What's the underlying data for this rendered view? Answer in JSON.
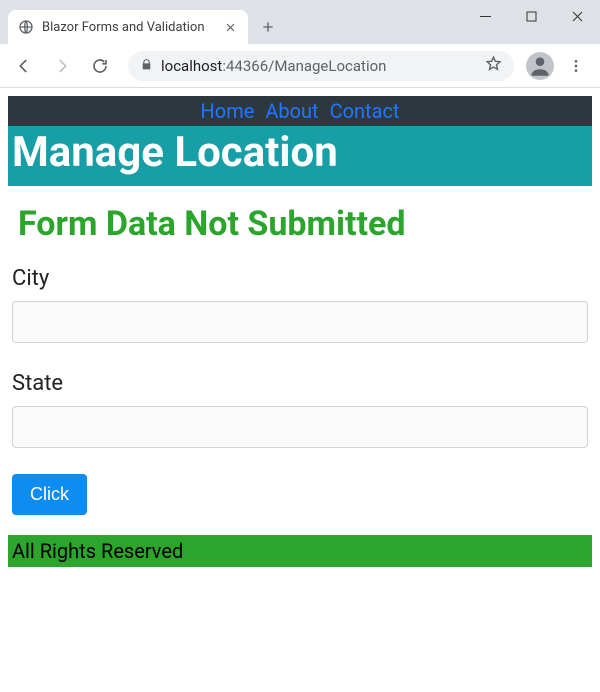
{
  "window": {
    "tab_title": "Blazor Forms and Validation",
    "url_host": "localhost",
    "url_port": "44366",
    "url_path": "/ManageLocation"
  },
  "nav": {
    "items": [
      "Home",
      "About",
      "Contact"
    ]
  },
  "page": {
    "heading": "Manage Location",
    "status": "Form Data Not Submitted"
  },
  "form": {
    "city_label": "City",
    "city_value": "",
    "state_label": "State",
    "state_value": "",
    "submit_label": "Click"
  },
  "footer": {
    "text": "All Rights Reserved"
  }
}
